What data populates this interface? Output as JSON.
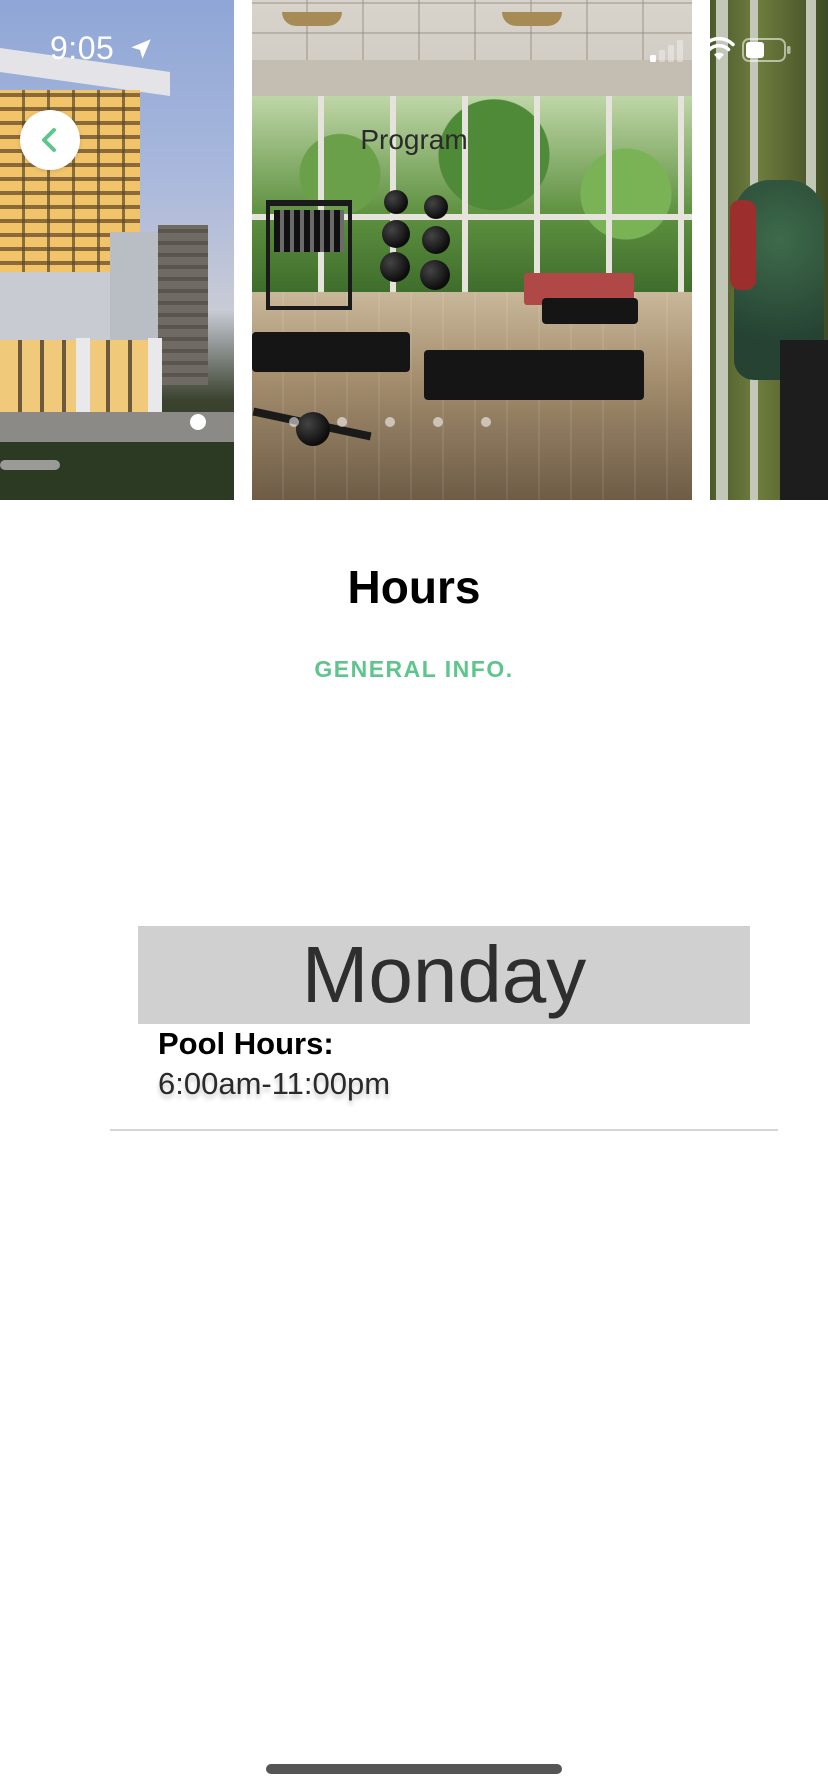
{
  "status_bar": {
    "time": "9:05",
    "location_icon": "location-arrow-icon",
    "signal_icon": "cellular-signal-icon",
    "wifi_icon": "wifi-icon",
    "battery_icon": "battery-icon"
  },
  "carousel": {
    "title": "Program",
    "slides": [
      "building-photo",
      "gym-photo",
      "hiker-photo"
    ],
    "dot_count": 7,
    "active_dot": 1
  },
  "back_button": {
    "icon": "chevron-left-icon"
  },
  "page": {
    "title": "Hours",
    "section_label": "GENERAL INFO."
  },
  "schedule": {
    "day": "Monday",
    "hours_label": "Pool Hours:",
    "hours_value": "6:00am-11:00pm"
  },
  "colors": {
    "accent": "#5ec68d",
    "day_header_bg": "#d0d0d0",
    "divider": "#d6d6d6"
  }
}
